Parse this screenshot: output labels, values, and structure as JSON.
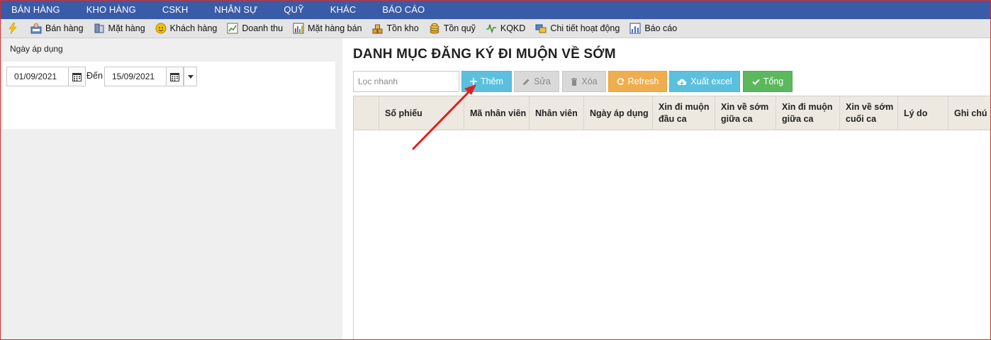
{
  "topmenu": [
    "BÁN HÀNG",
    "KHO HÀNG",
    "CSKH",
    "NHÂN SỰ",
    "QUỸ",
    "KHÁC",
    "BÁO CÁO"
  ],
  "toolbar": [
    {
      "label": "",
      "icon": "lightning-icon"
    },
    {
      "label": "Bán hàng",
      "icon": "cashier-icon"
    },
    {
      "label": "Mặt hàng",
      "icon": "product-icon"
    },
    {
      "label": "Khách hàng",
      "icon": "customer-icon"
    },
    {
      "label": "Doanh thu",
      "icon": "revenue-icon"
    },
    {
      "label": "Mặt hàng bán",
      "icon": "bar-chart-icon"
    },
    {
      "label": "Tồn kho",
      "icon": "stock-icon"
    },
    {
      "label": "Tồn quỹ",
      "icon": "coins-icon"
    },
    {
      "label": "KQKD",
      "icon": "pulse-icon"
    },
    {
      "label": "Chi tiết hoạt động",
      "icon": "activity-icon"
    },
    {
      "label": "Báo cáo",
      "icon": "report-icon"
    }
  ],
  "left": {
    "label": "Ngày áp dụng",
    "from_date": "01/09/2021",
    "to_label": "Đến",
    "to_date": "15/09/2021"
  },
  "main": {
    "title": "DANH MỤC ĐĂNG KÝ ĐI MUỘN VỀ SỚM",
    "filter_placeholder": "Lọc nhanh",
    "buttons": {
      "add": "Thêm",
      "edit": "Sửa",
      "delete": "Xóa",
      "refresh": "Refresh",
      "export": "Xuất excel",
      "total": "Tổng"
    },
    "columns": [
      "",
      "Số phiếu",
      "Mã nhân viên",
      "Nhân viên",
      "Ngày áp dụng",
      "Xin đi muộn đầu ca",
      "Xin về sớm giữa ca",
      "Xin đi muộn giữa ca",
      "Xin về sớm cuối ca",
      "Lý do",
      "Ghi chú"
    ]
  },
  "colors": {
    "menu_bg": "#3a5ba8",
    "add_button": "#5bc0de",
    "refresh_button": "#f0ad4e",
    "total_button": "#5cb85c",
    "annotation_arrow": "#e02020"
  }
}
